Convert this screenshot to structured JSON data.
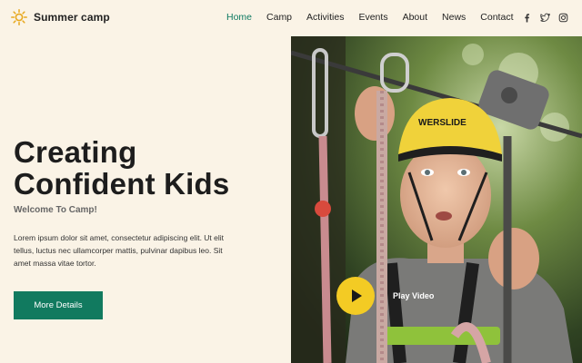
{
  "brand": {
    "name": "Summer camp",
    "icon": "sun-icon"
  },
  "nav": {
    "items": [
      {
        "label": "Home",
        "active": true
      },
      {
        "label": "Camp",
        "active": false
      },
      {
        "label": "Activities",
        "active": false
      },
      {
        "label": "Events",
        "active": false
      },
      {
        "label": "About",
        "active": false
      },
      {
        "label": "News",
        "active": false
      },
      {
        "label": "Contact",
        "active": false
      }
    ]
  },
  "social": [
    {
      "icon": "facebook-icon"
    },
    {
      "icon": "twitter-icon"
    },
    {
      "icon": "instagram-icon"
    }
  ],
  "hero": {
    "title_line1": "Creating",
    "title_line2": "Confident Kids",
    "subtitle": "Welcome To Camp!",
    "text": "Lorem ipsum dolor sit amet, consectetur adipiscing elit. Ut elit tellus, luctus nec ullamcorper mattis, pulvinar dapibus leo. Sit amet massa vitae tortor.",
    "button_label": "More Details",
    "play_label": "Play Video",
    "helmet_text": "WERSLIDE"
  },
  "colors": {
    "accent": "#117a5f",
    "active_nav": "#0e7a62",
    "background": "#faf3e6",
    "play_button": "#f3cb24"
  }
}
